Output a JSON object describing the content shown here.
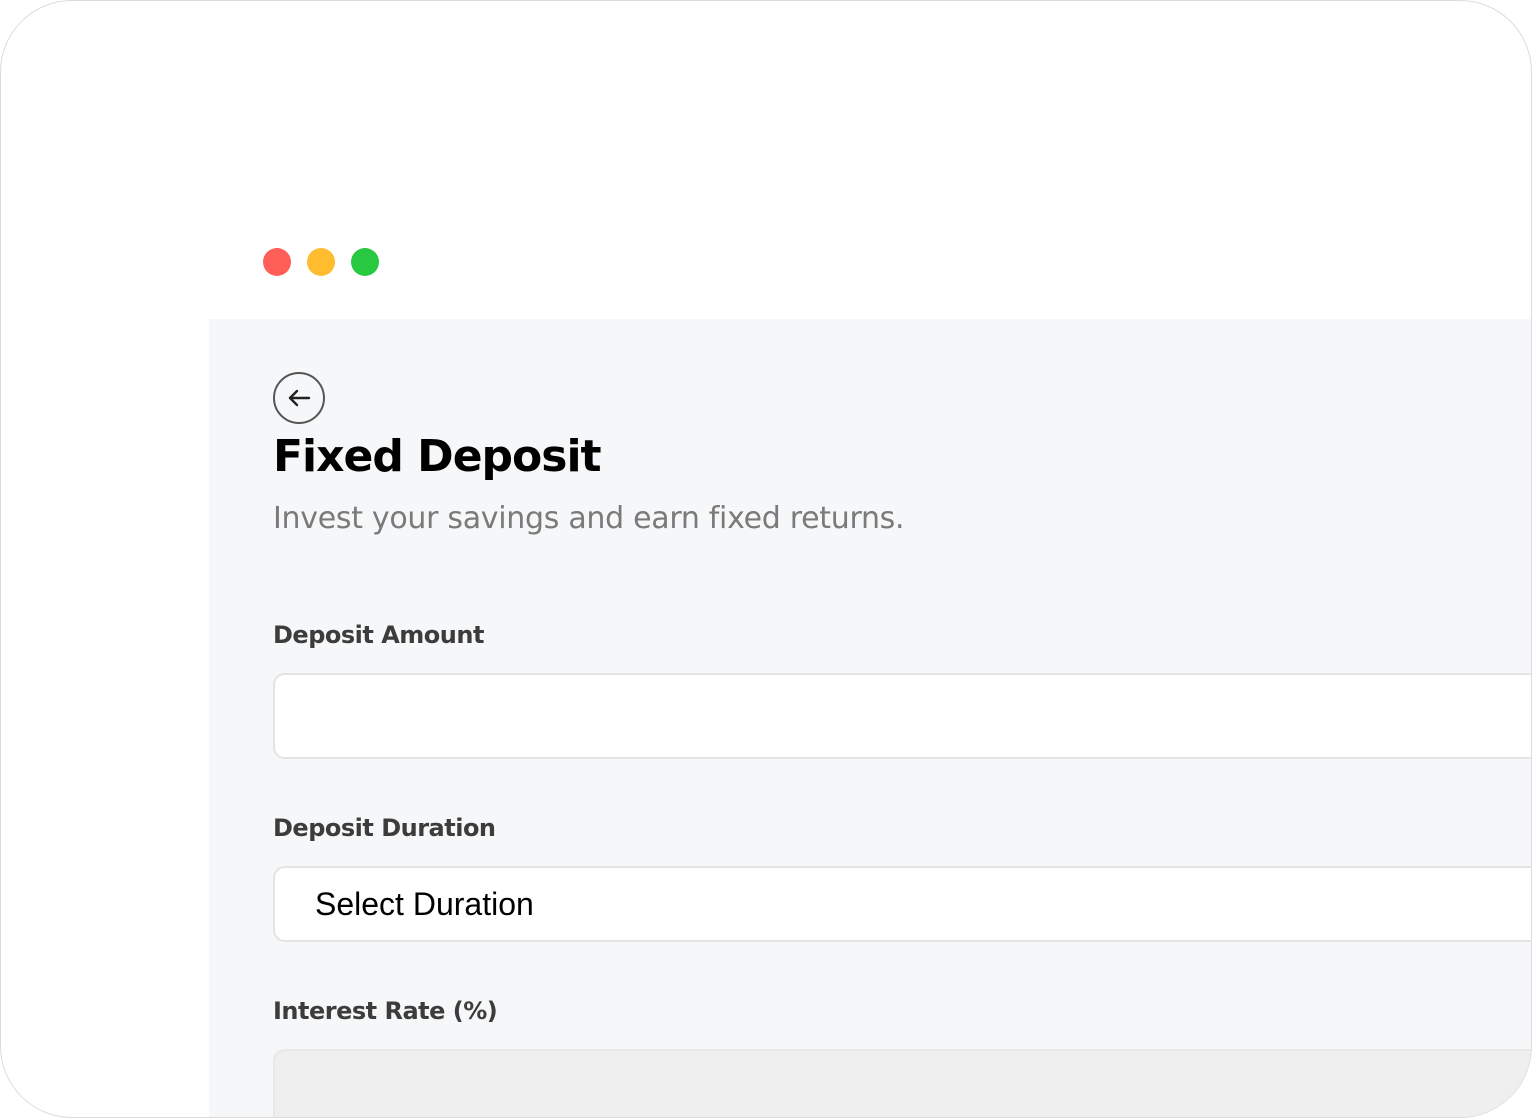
{
  "window": {
    "controls": [
      "close",
      "minimize",
      "maximize"
    ],
    "colors": {
      "close": "#ff5f57",
      "minimize": "#febc2e",
      "maximize": "#28c840"
    }
  },
  "page": {
    "back_icon": "arrow-left-icon",
    "title": "Fixed Deposit",
    "subtitle": "Invest your savings and earn fixed returns."
  },
  "form": {
    "amount": {
      "label": "Deposit Amount",
      "value": "",
      "placeholder": ""
    },
    "duration": {
      "label": "Deposit Duration",
      "selected": "Select Duration"
    },
    "rate": {
      "label": "Interest Rate (%)",
      "value": ""
    }
  }
}
